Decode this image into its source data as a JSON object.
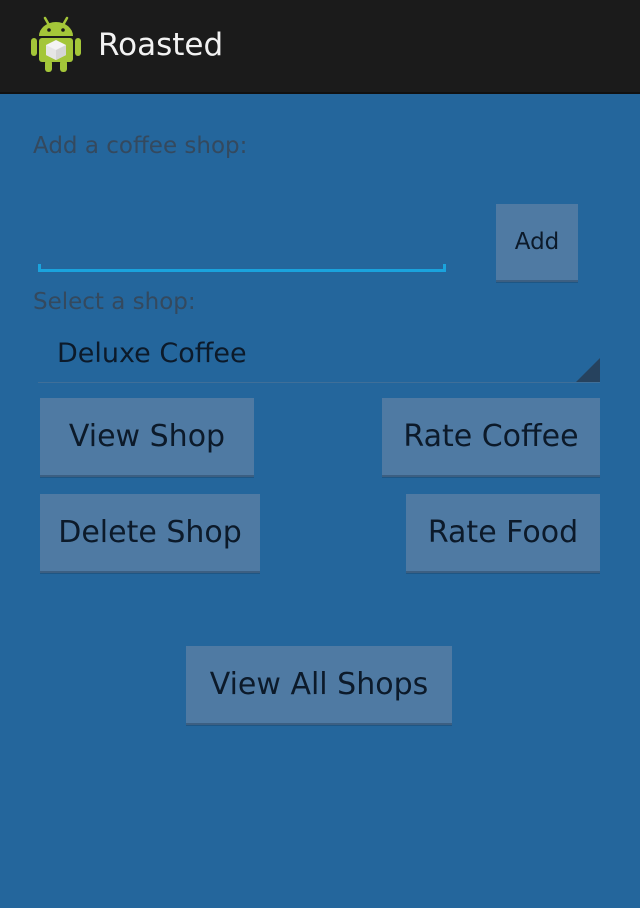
{
  "action_bar": {
    "title": "Roasted",
    "icon": "android-robot-icon"
  },
  "add_section": {
    "label": "Add a coffee shop:",
    "input_value": "",
    "input_placeholder": "",
    "add_button": "Add"
  },
  "select_section": {
    "label": "Select a shop:",
    "selected_shop": "Deluxe Coffee"
  },
  "actions": {
    "view_shop": "View Shop",
    "rate_coffee": "Rate Coffee",
    "delete_shop": "Delete Shop",
    "rate_food": "Rate Food",
    "view_all_shops": "View All Shops"
  },
  "colors": {
    "background": "#24669c",
    "action_bar": "#1b1b1b",
    "button": "#4f7aa3",
    "input_underline": "#1aa3dd"
  }
}
